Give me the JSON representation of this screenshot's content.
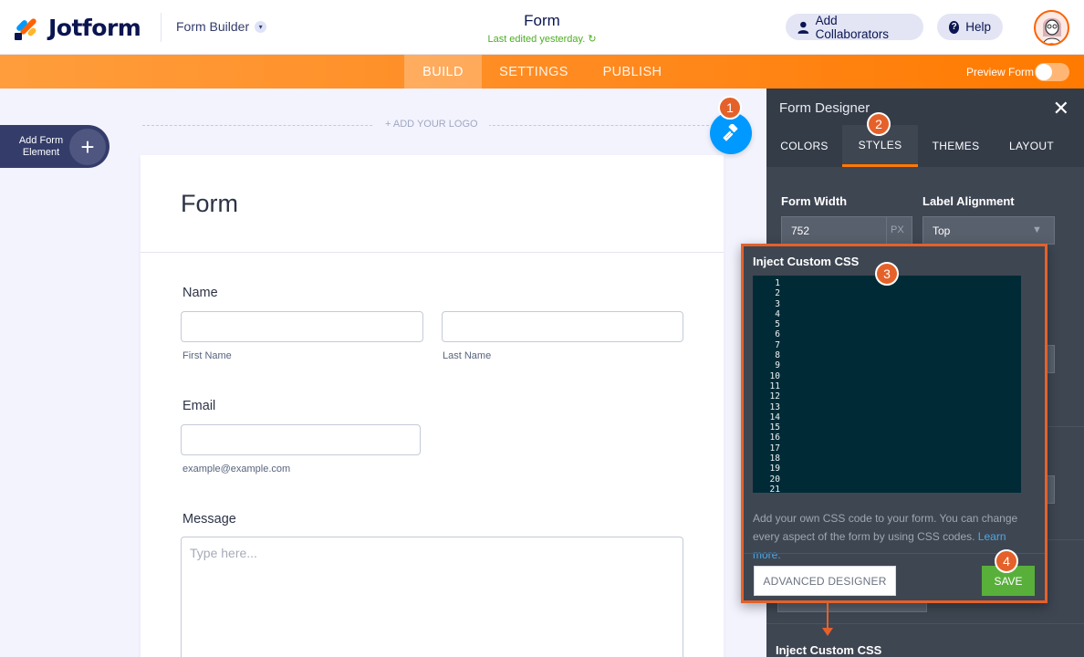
{
  "header": {
    "brand": "Jotform",
    "builder_label": "Form Builder",
    "form_title": "Form",
    "last_edited": "Last edited yesterday.",
    "collaborators_label": "Add Collaborators",
    "help_label": "Help"
  },
  "nav": {
    "tabs": [
      {
        "label": "BUILD",
        "active": true
      },
      {
        "label": "SETTINGS",
        "active": false
      },
      {
        "label": "PUBLISH",
        "active": false
      }
    ],
    "preview_label": "Preview Form",
    "preview_on": false
  },
  "add_element": {
    "label": "Add Form Element"
  },
  "logo_placeholder": "+ ADD YOUR LOGO",
  "form": {
    "title": "Form",
    "fields": {
      "name_label": "Name",
      "first_name_sub": "First Name",
      "last_name_sub": "Last Name",
      "email_label": "Email",
      "email_sub": "example@example.com",
      "message_label": "Message",
      "message_placeholder": "Type here..."
    }
  },
  "panel": {
    "title": "Form Designer",
    "tabs": [
      {
        "label": "COLORS",
        "active": false
      },
      {
        "label": "STYLES",
        "active": true
      },
      {
        "label": "THEMES",
        "active": false
      },
      {
        "label": "LAYOUT",
        "active": false
      }
    ],
    "form_width_label": "Form Width",
    "form_width_value": "752",
    "form_width_unit": "PX",
    "label_alignment_label": "Label Alignment",
    "label_alignment_value": "Top",
    "bottom_label": "Inject Custom CSS"
  },
  "css_popup": {
    "title": "Inject Custom CSS",
    "line_numbers": [
      "1",
      "2",
      "3",
      "4",
      "5",
      "6",
      "7",
      "8",
      "9",
      "10",
      "11",
      "12",
      "13",
      "14",
      "15",
      "16",
      "17",
      "18",
      "19",
      "20",
      "21"
    ],
    "description": "Add your own CSS code to your form. You can change every aspect of the form by using CSS codes. ",
    "learn_more": "Learn more.",
    "advanced_button": "ADVANCED DESIGNER",
    "save_button": "SAVE"
  },
  "step_badges": [
    "1",
    "2",
    "3",
    "4"
  ],
  "colors": {
    "brand_orange": "#ff7a00",
    "designer_blue": "#0099ff",
    "highlight": "#e5612a",
    "save_green": "#58b03b",
    "panel_bg": "#3e4652",
    "code_bg": "#002b36"
  }
}
